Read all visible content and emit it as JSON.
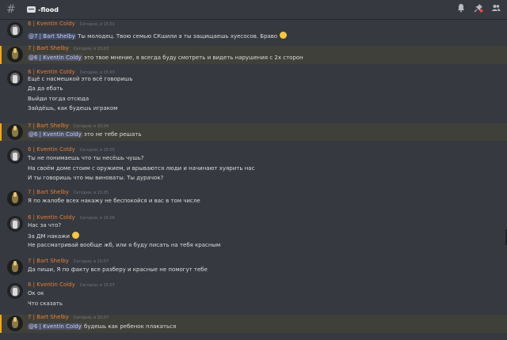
{
  "channel": {
    "hash": "#",
    "name": "-flood"
  },
  "toolbar_icons": [
    "bell-icon",
    "pin-icon",
    "members-icon"
  ],
  "messages": [
    {
      "author": "6 | Kventin Coldy",
      "timestamp": "Сегодня, в 15:01",
      "highlighted": false,
      "lines": [
        {
          "mention": "@7 | Bart Shelby",
          "text": " Ты молодец. Твою семью СКшили а ты защищаешь хуесосов. Браво",
          "emoji": true
        }
      ]
    },
    {
      "author": "7 | Bart Shelby",
      "timestamp": "Сегодня, в 15:03",
      "highlighted": true,
      "lines": [
        {
          "mention": "@6 | Kventin Coldy",
          "text": " это твое мнение, я всегда буду смотреть  и видеть нарушения с 2х сторон"
        }
      ]
    },
    {
      "author": "6 | Kventin Coldy",
      "timestamp": "Сегодня, в 15:03",
      "highlighted": false,
      "lines": [
        {
          "text": "Ещё с насмешкой это всё говоришь"
        },
        {
          "text": "Да да ебать"
        },
        {
          "text": "Выйди тогда отсюда"
        },
        {
          "text": "Зайдёшь, как будешь играком"
        }
      ]
    },
    {
      "author": "7 | Bart Shelby",
      "timestamp": "Сегодня, в 15:04",
      "highlighted": true,
      "lines": [
        {
          "mention": "@6 | Kventin Coldy",
          "text": " это не тебе решать"
        }
      ]
    },
    {
      "author": "6 | Kventin Coldy",
      "timestamp": "Сегодня, в 15:05",
      "highlighted": false,
      "lines": [
        {
          "text": "Ты не понимаешь что ты несёшь чушь?"
        },
        {
          "text": "На своём доме стоим с оружием, и врываются люди и начинают хуярить нас"
        },
        {
          "text": "И ты говоришь что мы виноваты. Ты дурачок?"
        }
      ]
    },
    {
      "author": "7 | Bart Shelby",
      "timestamp": "Сегодня, в 15:05",
      "highlighted": false,
      "lines": [
        {
          "text": "Я по жалобе всех накажу не беспокойся и вас в том числе"
        }
      ]
    },
    {
      "author": "6 | Kventin Coldy",
      "timestamp": "Сегодня, в 15:06",
      "highlighted": false,
      "lines": [
        {
          "text": "Нас за что?"
        },
        {
          "text": "За ДМ накажи",
          "emoji": true
        },
        {
          "text": "Не рассматривай вообще жб, или я буду писать на тебя красным"
        }
      ]
    },
    {
      "author": "7 | Bart Shelby",
      "timestamp": "Сегодня, в 15:07",
      "highlighted": false,
      "lines": [
        {
          "text": "Да пиши, Я по факту все разберу и красные не помогут тебе"
        }
      ]
    },
    {
      "author": "6 | Kventin Coldy",
      "timestamp": "Сегодня, в 15:07",
      "highlighted": false,
      "lines": [
        {
          "text": "Ок ок"
        },
        {
          "text": "Что сказать"
        }
      ]
    },
    {
      "author": "7 | Bart Shelby",
      "timestamp": "Сегодня, в 15:07",
      "highlighted": true,
      "lines": [
        {
          "mention": "@6 | Kventin Coldy",
          "text": "  будешь как ребенок плакаться"
        }
      ]
    }
  ]
}
